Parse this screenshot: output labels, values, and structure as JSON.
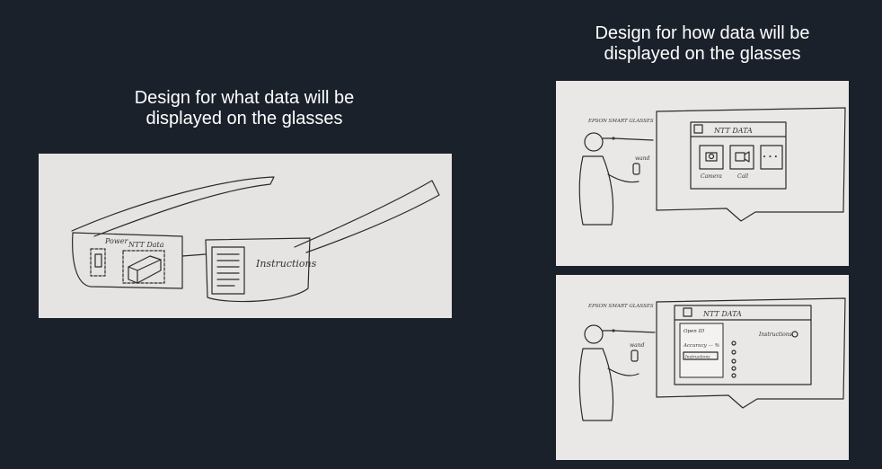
{
  "slides": {
    "left": {
      "caption": "Design for what data will be\ndisplayed on the glasses",
      "sketch_labels": {
        "power": "Power",
        "ntt_data": "NTT Data",
        "instructions": "Instructions"
      }
    },
    "right": {
      "caption": "Design for how data will be\ndisplayed on the glasses",
      "top_sketch": {
        "glasses_label": "EPSON SMART GLASSES",
        "wand_label": "wand",
        "header_title": "NTT DATA",
        "apps": [
          "Camera",
          "Call"
        ],
        "more": "• • •"
      },
      "bottom_sketch": {
        "glasses_label": "EPSON SMART GLASSES",
        "wand_label": "wand",
        "header_title": "NTT DATA",
        "menu": [
          "Open ID",
          "Accuracy — %",
          "Instructions"
        ],
        "panel_title": "Instructions"
      }
    }
  }
}
